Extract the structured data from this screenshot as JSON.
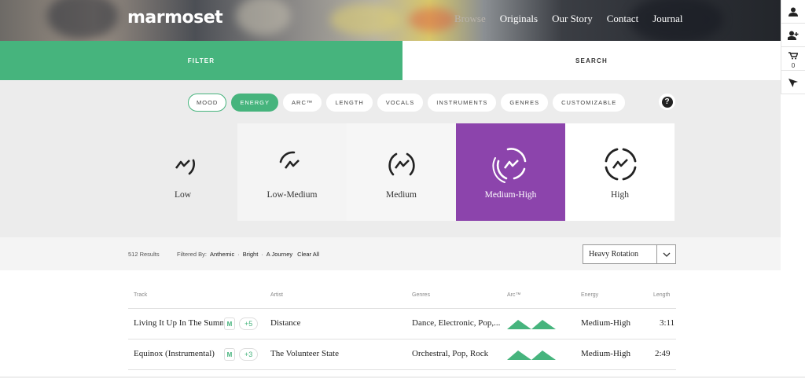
{
  "brand": {
    "logo_text": "marmoset"
  },
  "topnav": [
    "Browse",
    "Originals",
    "Our Story",
    "Contact",
    "Journal"
  ],
  "rail": {
    "cart_count": "0",
    "icons": [
      "user-icon",
      "add-user-icon",
      "cart-icon",
      "cursor-icon"
    ]
  },
  "tabs": {
    "filter": "FILTER",
    "search": "SEARCH"
  },
  "pills": [
    "MOOD",
    "ENERGY",
    "ARC™",
    "LENGTH",
    "VOCALS",
    "INSTRUMENTS",
    "GENRES",
    "CUSTOMIZABLE"
  ],
  "help": "?",
  "energy_levels": [
    "Low",
    "Low-Medium",
    "Medium",
    "Medium-High",
    "High"
  ],
  "selected_energy": "Medium-High",
  "results": {
    "count": "512 Results",
    "filtered_label": "Filtered By:",
    "filters": [
      "Anthemic",
      "Bright",
      "A Journey"
    ],
    "clear_all": "Clear All",
    "sort": "Heavy Rotation"
  },
  "table": {
    "headers": [
      "Track",
      "Artist",
      "Genres",
      "Arc™",
      "Energy",
      "Length"
    ],
    "rows": [
      {
        "track": "Living It Up In The Summer",
        "badge": "M",
        "plus": "+5",
        "artist": "Distance",
        "genres": "Dance, Electronic, Pop,...",
        "energy": "Medium-High",
        "length": "3:11"
      },
      {
        "track": "Equinox (Instrumental)",
        "badge": "M",
        "plus": "+3",
        "artist": "The Volunteer State",
        "genres": "Orchestral, Pop, Rock",
        "energy": "Medium-High",
        "length": "2:49"
      }
    ]
  },
  "colors": {
    "green": "#46b47d",
    "purple": "#8c44ac"
  }
}
